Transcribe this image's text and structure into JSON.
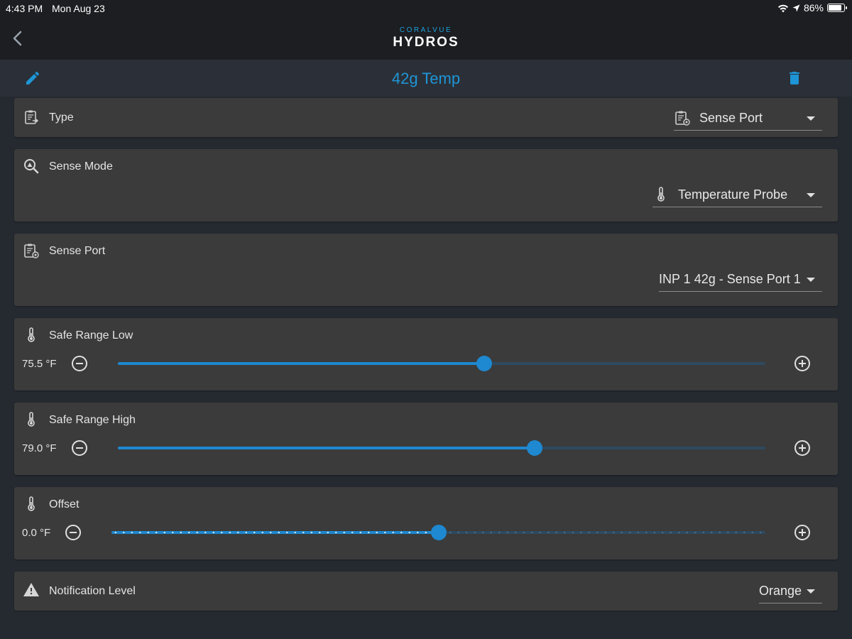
{
  "status_bar": {
    "time": "4:43 PM",
    "date": "Mon Aug 23",
    "battery": "86%",
    "battery_level": 0.86
  },
  "nav": {
    "brand_small": "CORALVUE",
    "brand_big": "HYDROS"
  },
  "header": {
    "title": "42g Temp",
    "accent_color": "#1e95d6"
  },
  "type": {
    "label": "Type",
    "value": "Sense Port"
  },
  "sense_mode": {
    "label": "Sense Mode",
    "value": "Temperature Probe"
  },
  "sense_port": {
    "label": "Sense Port",
    "value": "INP 1 42g - Sense Port 1"
  },
  "safe_range_low": {
    "label": "Safe Range Low",
    "value": "75.5 °F",
    "slider_fraction": 0.566
  },
  "safe_range_high": {
    "label": "Safe Range High",
    "value": "79.0 °F",
    "slider_fraction": 0.644
  },
  "offset": {
    "label": "Offset",
    "value": "0.0 °F",
    "slider_fraction": 0.5
  },
  "notification": {
    "label": "Notification Level",
    "value": "Orange"
  }
}
